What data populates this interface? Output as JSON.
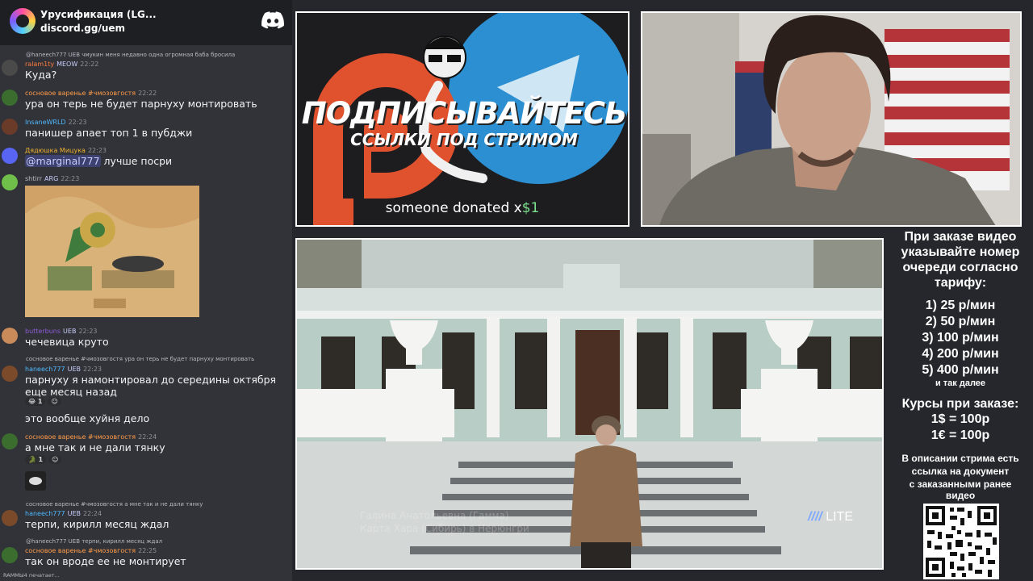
{
  "server": {
    "name": "Урусификация (LG...",
    "link": "discord.gg/uem"
  },
  "messages": [
    {
      "reply": "@haneech777 UEB чмукин меня недавно одна огромная баба бросила",
      "user": "ralam1ty",
      "user_color": "#ff7a3d",
      "tag": "MEOW",
      "time": "22:22",
      "text": "Куда?",
      "avatar": "#4a4a4a"
    },
    {
      "user": "сосновое варенье #чмозовгостя",
      "user_color": "#ff9b4a",
      "time": "22:22",
      "text": "ура он терь не будет парнуху монтировать",
      "avatar": "#3b6d2f"
    },
    {
      "user": "InsaneWRLD",
      "user_color": "#4fb8ff",
      "time": "22:23",
      "text": "панишер апает топ 1 в пубджи",
      "avatar": "#6b3b2a"
    },
    {
      "user": "Дядюшка Мицука",
      "user_color": "#f0b232",
      "time": "22:23",
      "mention": "@marginal777",
      "text": " лучше посри",
      "avatar": "#5865f2"
    },
    {
      "user": "shtirr",
      "user_color": "#b5bac1",
      "tag": "ARG",
      "time": "22:23",
      "avatar": "#6fbf4a"
    },
    {
      "user": "butterbuns",
      "user_color": "#8f5bd7",
      "tag": "UEB",
      "time": "22:23",
      "text": "чечевица круто",
      "avatar": "#c98b5a"
    },
    {
      "reply": "сосновое варенье #чмозовгостя ура он терь не будет парнуху монтировать",
      "user": "haneech777",
      "user_color": "#4fb8ff",
      "tag": "UEB",
      "time": "22:23",
      "text": "парнуху я намонтировал до середины октября еще месяц назад",
      "avatar": "#7a4a2a",
      "reaction": "1"
    },
    {
      "text": "это вообще хуйня дело"
    },
    {
      "user": "сосновое варенье #чмозовгостя",
      "user_color": "#ff9b4a",
      "time": "22:24",
      "text": "а мне так и не дали тянку",
      "avatar": "#3b6d2f",
      "reaction": "1"
    },
    {
      "reply": "сосновое варенье #чмозовгостя а мне так и не дали тянку",
      "user": "haneech777",
      "user_color": "#4fb8ff",
      "tag": "UEB",
      "time": "22:24",
      "text": "терпи, кирилл месяц ждал",
      "avatar": "#7a4a2a"
    },
    {
      "reply": "@haneech777 UEB терпи, кирилл месяц ждал",
      "user": "сосновое варенье #чмозовгостя",
      "user_color": "#ff9b4a",
      "time": "22:25",
      "text": "так он вроде ее не монтирует",
      "avatar": "#3b6d2f"
    }
  ],
  "typing": "RAMMЫ4 печатает...",
  "promo": {
    "title": "ПОДПИСЫВАЙТЕСЬ",
    "subtitle": "ССЫЛКИ ПОД СТРИМОМ",
    "donation_prefix": "someone donated x",
    "donation_amount": "$1"
  },
  "video": {
    "badge": "LITE",
    "caption_line1": "Галина Анатольевна (Гамма)",
    "caption_line2": "Карта Хара (Сибирь) в Нерюнгри"
  },
  "info": {
    "heading": [
      "При заказе видео",
      "указывайте номер",
      "очереди согласно",
      "тарифу:"
    ],
    "tariffs": [
      "1) 25 р/мин",
      "2) 50 р/мин",
      "3) 100 р/мин",
      "4) 200 р/мин",
      "5) 400 р/мин"
    ],
    "and_so_on": "и так далее",
    "rates_heading": "Курсы при заказе:",
    "rates": [
      "1$ = 100р",
      "1€ = 100р"
    ],
    "description": [
      "В описании стрима есть",
      "ссылка на документ",
      "с заказанными ранее",
      "видео"
    ]
  },
  "colors": {
    "background": "#26272d",
    "chat_bg": "#313338",
    "discord_blurple": "#5865f2",
    "accent_green": "#7be08c"
  }
}
